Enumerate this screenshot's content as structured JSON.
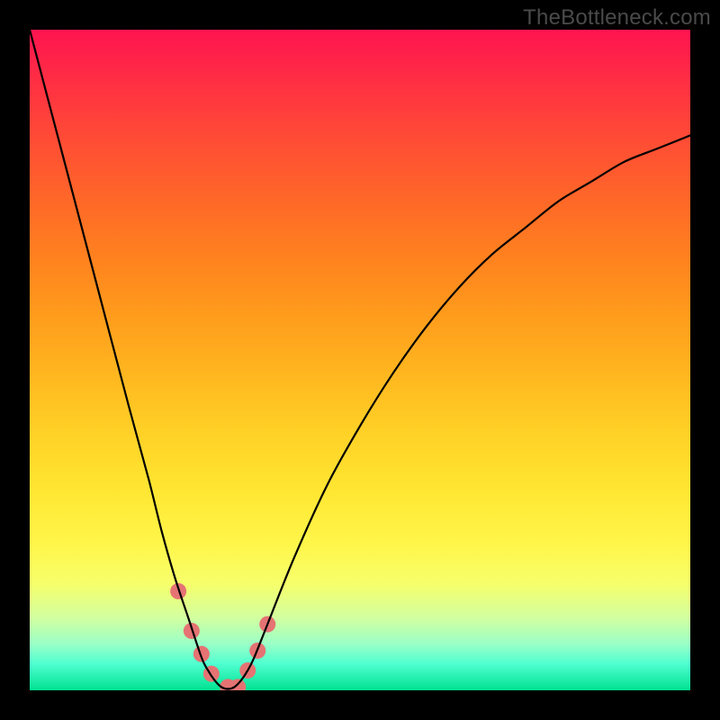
{
  "watermark": "TheBottleneck.com",
  "chart_data": {
    "type": "line",
    "title": "",
    "xlabel": "",
    "ylabel": "",
    "xlim": [
      0,
      100
    ],
    "ylim": [
      0,
      100
    ],
    "series": [
      {
        "name": "bottleneck-curve",
        "x": [
          0,
          5,
          10,
          15,
          18,
          20,
          22,
          24,
          26,
          27,
          28,
          29,
          30,
          31,
          32,
          33,
          34,
          36,
          40,
          45,
          50,
          55,
          60,
          65,
          70,
          75,
          80,
          85,
          90,
          95,
          100
        ],
        "values": [
          100,
          81,
          62,
          43,
          32,
          24,
          17,
          11,
          5,
          3,
          1.5,
          0.5,
          0.2,
          0.5,
          1.5,
          3,
          5,
          10,
          20,
          31,
          40,
          48,
          55,
          61,
          66,
          70,
          74,
          77,
          80,
          82,
          84
        ]
      }
    ],
    "dot_markers": {
      "comment": "salmon dots near the curve minimum",
      "color": "#e57373",
      "points": [
        {
          "x": 22.5,
          "y": 15
        },
        {
          "x": 24.5,
          "y": 9
        },
        {
          "x": 26,
          "y": 5.5
        },
        {
          "x": 27.5,
          "y": 2.5
        },
        {
          "x": 30,
          "y": 0.5
        },
        {
          "x": 31.5,
          "y": 0.5
        },
        {
          "x": 33,
          "y": 3
        },
        {
          "x": 34.5,
          "y": 6
        },
        {
          "x": 36,
          "y": 10
        }
      ]
    },
    "gradient_stops": [
      {
        "pct": 0,
        "color": "#ff1450"
      },
      {
        "pct": 8,
        "color": "#ff2f43"
      },
      {
        "pct": 16,
        "color": "#ff4a36"
      },
      {
        "pct": 25,
        "color": "#ff6529"
      },
      {
        "pct": 34,
        "color": "#ff801f"
      },
      {
        "pct": 43,
        "color": "#ff9b1c"
      },
      {
        "pct": 52,
        "color": "#ffb61f"
      },
      {
        "pct": 61,
        "color": "#ffd126"
      },
      {
        "pct": 70,
        "color": "#ffe733"
      },
      {
        "pct": 78,
        "color": "#fff64a"
      },
      {
        "pct": 84,
        "color": "#f6ff6c"
      },
      {
        "pct": 89,
        "color": "#d2ffa0"
      },
      {
        "pct": 93,
        "color": "#9affc7"
      },
      {
        "pct": 96,
        "color": "#4fffd0"
      },
      {
        "pct": 100,
        "color": "#00e291"
      }
    ]
  }
}
